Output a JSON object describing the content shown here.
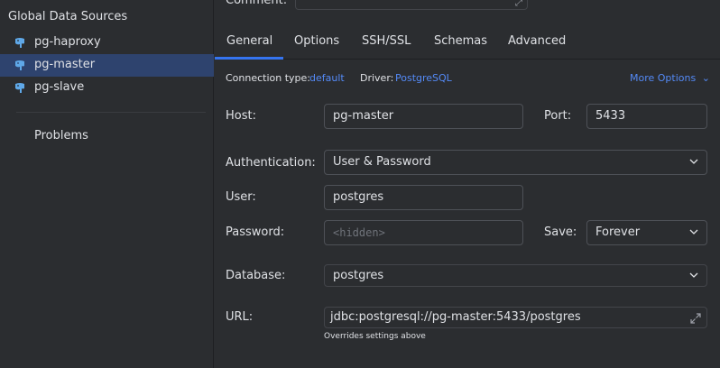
{
  "sidebar": {
    "title": "Global Data Sources",
    "items": [
      {
        "label": "pg-haproxy",
        "icon": "postgresql-elephant-icon"
      },
      {
        "label": "pg-master",
        "icon": "postgresql-elephant-icon",
        "selected": true
      },
      {
        "label": "pg-slave",
        "icon": "postgresql-elephant-icon"
      }
    ],
    "problems_label": "Problems"
  },
  "comment": {
    "label": "Comment:"
  },
  "tabs": [
    {
      "label": "General",
      "active": true
    },
    {
      "label": "Options"
    },
    {
      "label": "SSH/SSL"
    },
    {
      "label": "Schemas"
    },
    {
      "label": "Advanced"
    }
  ],
  "connection_info": {
    "type_label": "Connection type:",
    "type_value": "default",
    "driver_label": "Driver:",
    "driver_value": "PostgreSQL",
    "more_options": "More Options"
  },
  "form": {
    "host_label": "Host:",
    "host_value": "pg-master",
    "port_label": "Port:",
    "port_value": "5433",
    "auth_label": "Authentication:",
    "auth_value": "User & Password",
    "user_label": "User:",
    "user_value": "postgres",
    "password_label": "Password:",
    "password_placeholder": "<hidden>",
    "save_label": "Save:",
    "save_value": "Forever",
    "database_label": "Database:",
    "database_value": "postgres",
    "url_label": "URL:",
    "url_value": "jdbc:postgresql://pg-master:5433/postgres",
    "url_hint": "Overrides settings above"
  },
  "colors": {
    "accent": "#3574f0",
    "link": "#548af7",
    "selected_bg": "#2e436e",
    "postgres_blue": "#5fa8e8"
  }
}
